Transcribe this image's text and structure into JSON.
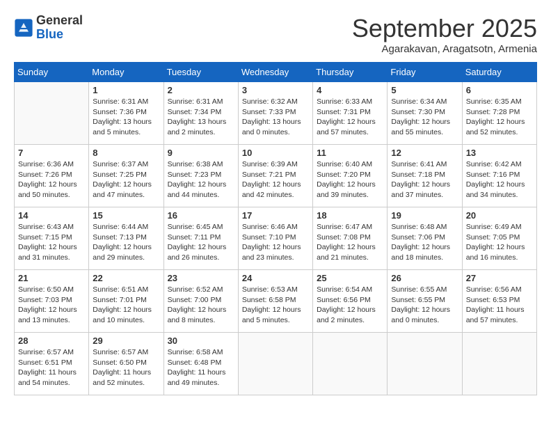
{
  "header": {
    "logo_line1": "General",
    "logo_line2": "Blue",
    "month": "September 2025",
    "location": "Agarakavan, Aragatsotn, Armenia"
  },
  "weekdays": [
    "Sunday",
    "Monday",
    "Tuesday",
    "Wednesday",
    "Thursday",
    "Friday",
    "Saturday"
  ],
  "weeks": [
    [
      {
        "day": "",
        "info": ""
      },
      {
        "day": "1",
        "info": "Sunrise: 6:31 AM\nSunset: 7:36 PM\nDaylight: 13 hours\nand 5 minutes."
      },
      {
        "day": "2",
        "info": "Sunrise: 6:31 AM\nSunset: 7:34 PM\nDaylight: 13 hours\nand 2 minutes."
      },
      {
        "day": "3",
        "info": "Sunrise: 6:32 AM\nSunset: 7:33 PM\nDaylight: 13 hours\nand 0 minutes."
      },
      {
        "day": "4",
        "info": "Sunrise: 6:33 AM\nSunset: 7:31 PM\nDaylight: 12 hours\nand 57 minutes."
      },
      {
        "day": "5",
        "info": "Sunrise: 6:34 AM\nSunset: 7:30 PM\nDaylight: 12 hours\nand 55 minutes."
      },
      {
        "day": "6",
        "info": "Sunrise: 6:35 AM\nSunset: 7:28 PM\nDaylight: 12 hours\nand 52 minutes."
      }
    ],
    [
      {
        "day": "7",
        "info": "Sunrise: 6:36 AM\nSunset: 7:26 PM\nDaylight: 12 hours\nand 50 minutes."
      },
      {
        "day": "8",
        "info": "Sunrise: 6:37 AM\nSunset: 7:25 PM\nDaylight: 12 hours\nand 47 minutes."
      },
      {
        "day": "9",
        "info": "Sunrise: 6:38 AM\nSunset: 7:23 PM\nDaylight: 12 hours\nand 44 minutes."
      },
      {
        "day": "10",
        "info": "Sunrise: 6:39 AM\nSunset: 7:21 PM\nDaylight: 12 hours\nand 42 minutes."
      },
      {
        "day": "11",
        "info": "Sunrise: 6:40 AM\nSunset: 7:20 PM\nDaylight: 12 hours\nand 39 minutes."
      },
      {
        "day": "12",
        "info": "Sunrise: 6:41 AM\nSunset: 7:18 PM\nDaylight: 12 hours\nand 37 minutes."
      },
      {
        "day": "13",
        "info": "Sunrise: 6:42 AM\nSunset: 7:16 PM\nDaylight: 12 hours\nand 34 minutes."
      }
    ],
    [
      {
        "day": "14",
        "info": "Sunrise: 6:43 AM\nSunset: 7:15 PM\nDaylight: 12 hours\nand 31 minutes."
      },
      {
        "day": "15",
        "info": "Sunrise: 6:44 AM\nSunset: 7:13 PM\nDaylight: 12 hours\nand 29 minutes."
      },
      {
        "day": "16",
        "info": "Sunrise: 6:45 AM\nSunset: 7:11 PM\nDaylight: 12 hours\nand 26 minutes."
      },
      {
        "day": "17",
        "info": "Sunrise: 6:46 AM\nSunset: 7:10 PM\nDaylight: 12 hours\nand 23 minutes."
      },
      {
        "day": "18",
        "info": "Sunrise: 6:47 AM\nSunset: 7:08 PM\nDaylight: 12 hours\nand 21 minutes."
      },
      {
        "day": "19",
        "info": "Sunrise: 6:48 AM\nSunset: 7:06 PM\nDaylight: 12 hours\nand 18 minutes."
      },
      {
        "day": "20",
        "info": "Sunrise: 6:49 AM\nSunset: 7:05 PM\nDaylight: 12 hours\nand 16 minutes."
      }
    ],
    [
      {
        "day": "21",
        "info": "Sunrise: 6:50 AM\nSunset: 7:03 PM\nDaylight: 12 hours\nand 13 minutes."
      },
      {
        "day": "22",
        "info": "Sunrise: 6:51 AM\nSunset: 7:01 PM\nDaylight: 12 hours\nand 10 minutes."
      },
      {
        "day": "23",
        "info": "Sunrise: 6:52 AM\nSunset: 7:00 PM\nDaylight: 12 hours\nand 8 minutes."
      },
      {
        "day": "24",
        "info": "Sunrise: 6:53 AM\nSunset: 6:58 PM\nDaylight: 12 hours\nand 5 minutes."
      },
      {
        "day": "25",
        "info": "Sunrise: 6:54 AM\nSunset: 6:56 PM\nDaylight: 12 hours\nand 2 minutes."
      },
      {
        "day": "26",
        "info": "Sunrise: 6:55 AM\nSunset: 6:55 PM\nDaylight: 12 hours\nand 0 minutes."
      },
      {
        "day": "27",
        "info": "Sunrise: 6:56 AM\nSunset: 6:53 PM\nDaylight: 11 hours\nand 57 minutes."
      }
    ],
    [
      {
        "day": "28",
        "info": "Sunrise: 6:57 AM\nSunset: 6:51 PM\nDaylight: 11 hours\nand 54 minutes."
      },
      {
        "day": "29",
        "info": "Sunrise: 6:57 AM\nSunset: 6:50 PM\nDaylight: 11 hours\nand 52 minutes."
      },
      {
        "day": "30",
        "info": "Sunrise: 6:58 AM\nSunset: 6:48 PM\nDaylight: 11 hours\nand 49 minutes."
      },
      {
        "day": "",
        "info": ""
      },
      {
        "day": "",
        "info": ""
      },
      {
        "day": "",
        "info": ""
      },
      {
        "day": "",
        "info": ""
      }
    ]
  ]
}
